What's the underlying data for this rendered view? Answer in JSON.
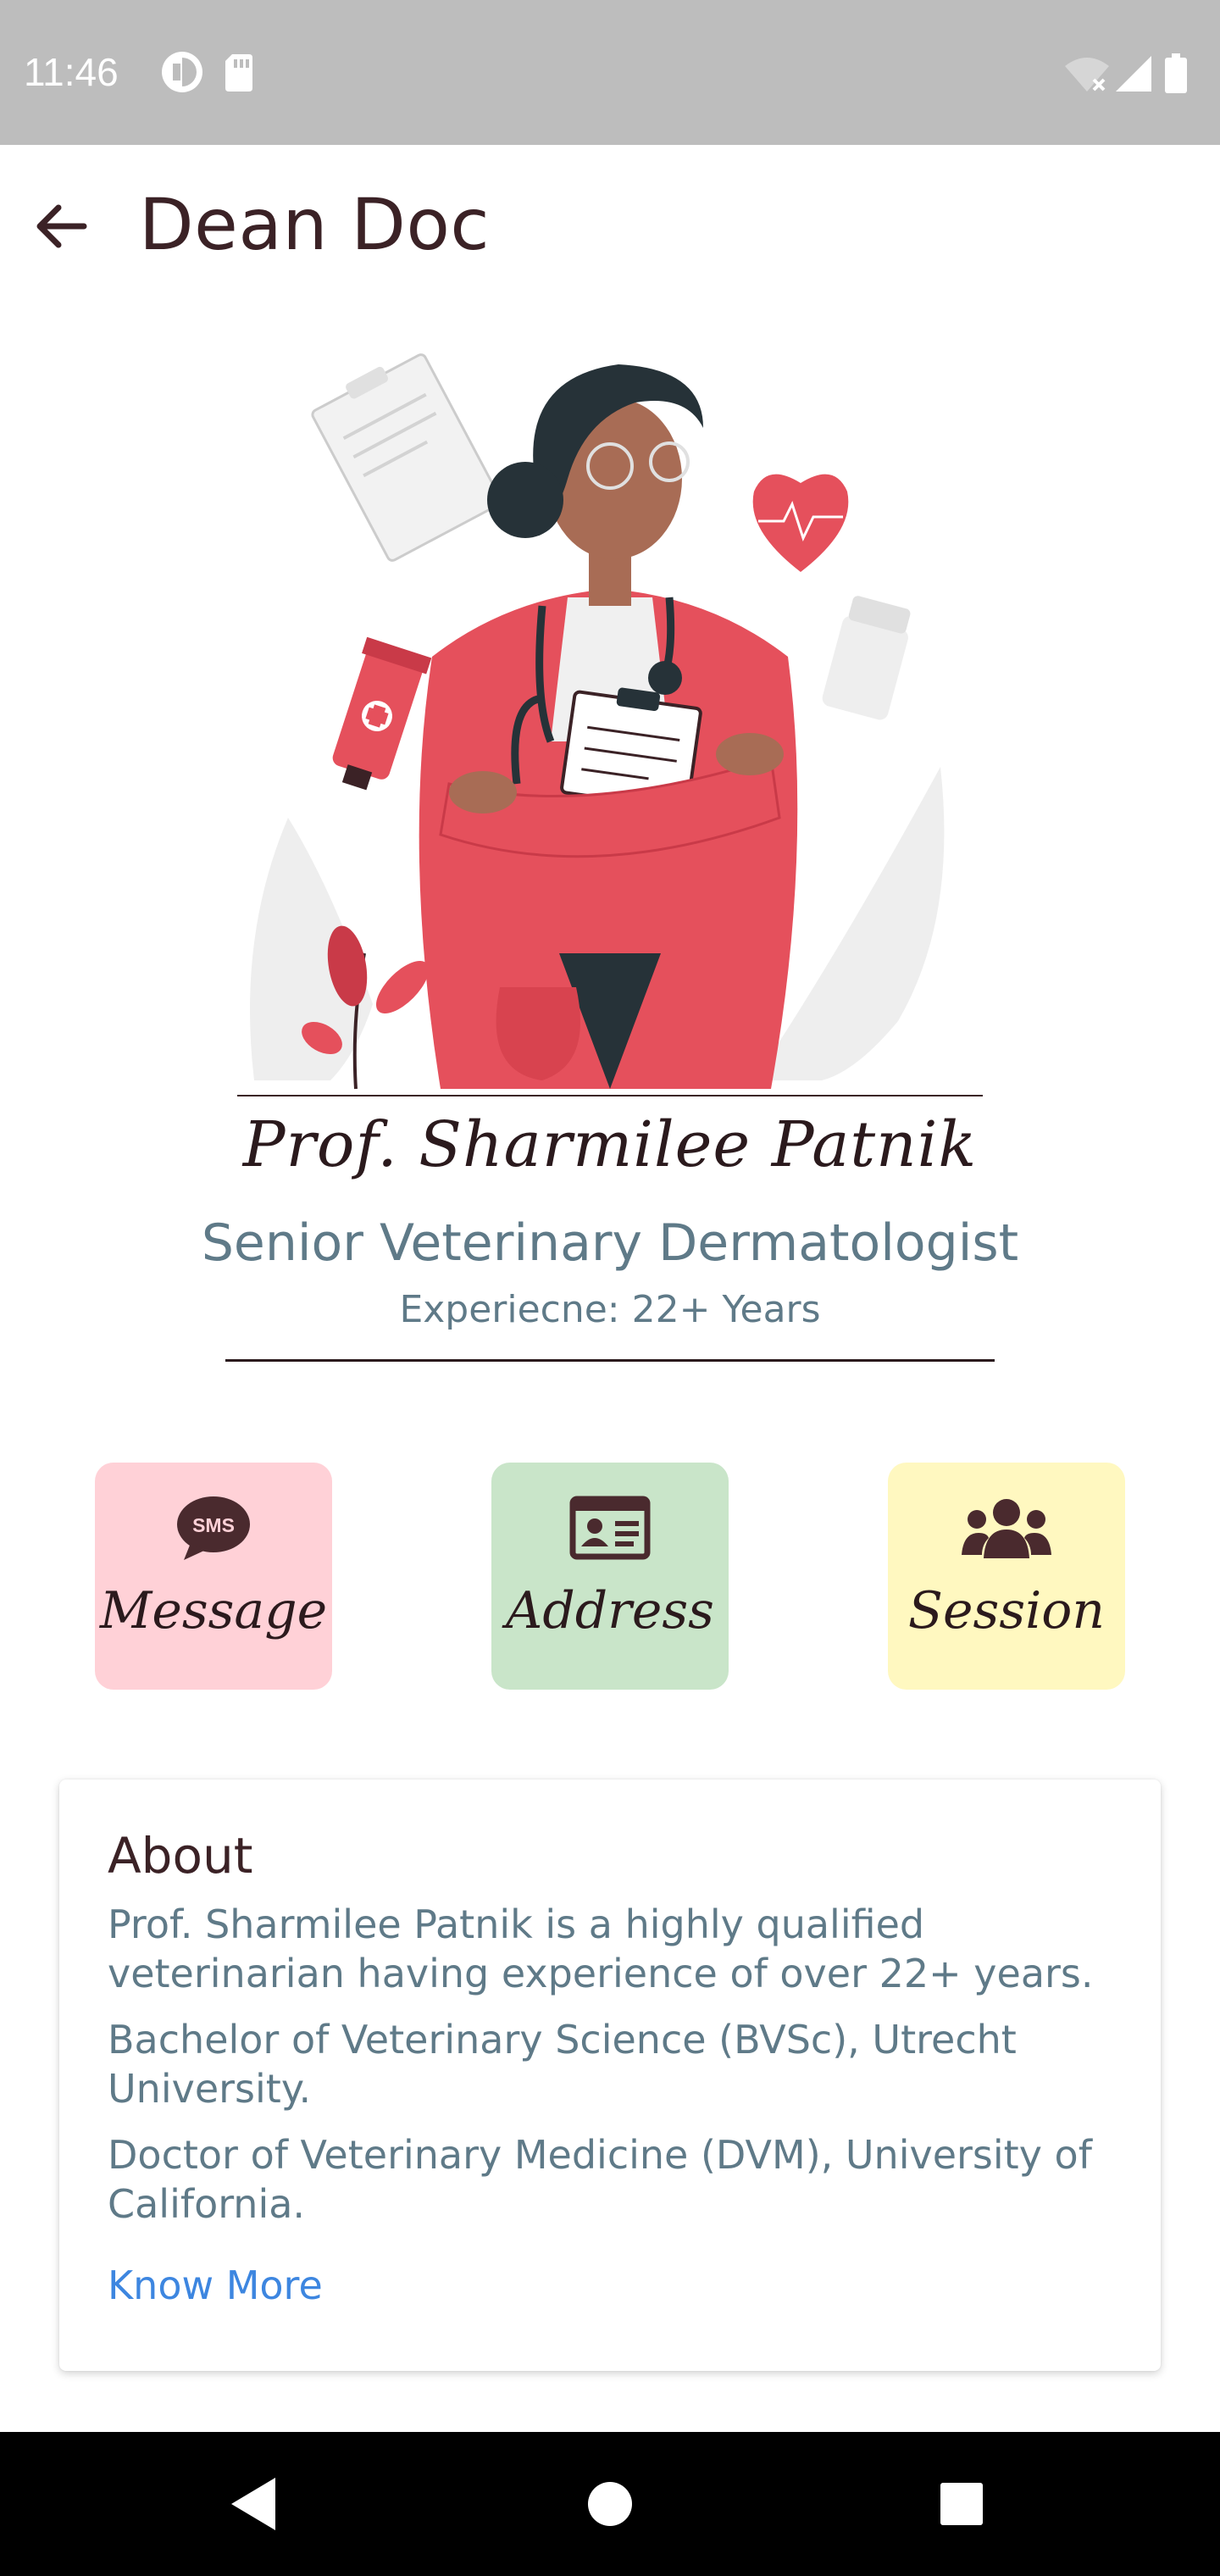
{
  "status_bar": {
    "time": "11:46",
    "left_icons": [
      "data-saver-icon",
      "sd-card-icon"
    ],
    "right_icons": [
      "wifi-off-icon",
      "signal-icon",
      "battery-icon"
    ]
  },
  "app_bar": {
    "title": "Dean Doc",
    "back_icon": "arrow-back-icon"
  },
  "profile": {
    "name": "Prof. Sharmilee Patnik",
    "title": "Senior Veterinary Dermatologist",
    "experience": "Experiecne: 22+ Years"
  },
  "actions": [
    {
      "label": "Message",
      "icon": "sms-icon",
      "color": "#ffd1d7"
    },
    {
      "label": "Address",
      "icon": "id-card-icon",
      "color": "#c9e5c9"
    },
    {
      "label": "Session",
      "icon": "users-icon",
      "color": "#fff8c0"
    }
  ],
  "about": {
    "heading": "About",
    "paragraphs": [
      "Prof. Sharmilee Patnik is a highly qualified veterinarian having experience of over 22+ years.",
      "Bachelor of Veterinary Science (BVSc), Utrecht University.",
      "Doctor of Veterinary Medicine (DVM), University of California."
    ],
    "link": "Know More"
  },
  "colors": {
    "accent": "#3d86e0",
    "secondary_text": "#5f7a88",
    "primary_text": "#3b2226"
  },
  "nav_bar": {
    "icons": [
      "nav-back-icon",
      "nav-home-icon",
      "nav-recents-icon"
    ]
  }
}
